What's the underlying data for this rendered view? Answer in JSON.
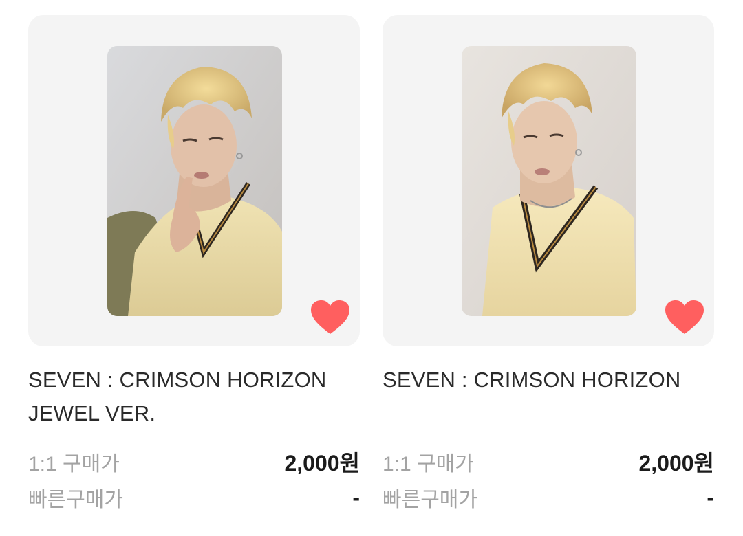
{
  "products": [
    {
      "title_line1": "SEVEN : CRIMSON HORIZON",
      "title_line2": "JEWEL VER.",
      "price_label_1": "1:1 구매가",
      "price_value_1": "2,000원",
      "price_label_2": "빠른구매가",
      "price_value_2": "-",
      "favorited": true
    },
    {
      "title_line1": "SEVEN : CRIMSON HORIZON",
      "title_line2": "",
      "price_label_1": "1:1 구매가",
      "price_value_1": "2,000원",
      "price_label_2": "빠른구매가",
      "price_value_2": "-",
      "favorited": true
    }
  ],
  "colors": {
    "card_bg": "#f4f4f4",
    "heart": "#ff5f5f",
    "title": "#2a2a2a",
    "label": "#a3a3a3",
    "price": "#1b1b1b"
  },
  "icons": {
    "favorite": "heart-icon"
  }
}
